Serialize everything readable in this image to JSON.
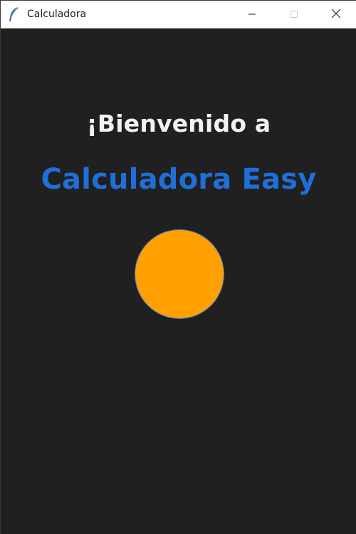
{
  "window": {
    "title": "Calculadora",
    "app_icon": "feather-icon",
    "controls": {
      "minimize_icon": "minimize-icon",
      "maximize_icon": "maximize-icon",
      "close_icon": "close-icon"
    }
  },
  "main": {
    "welcome_text": "¡Bienvenido a",
    "brand_text": "Calculadora Easy",
    "circle_color": "#ffa000",
    "background_color": "#202020",
    "brand_color": "#1f6fd8"
  }
}
